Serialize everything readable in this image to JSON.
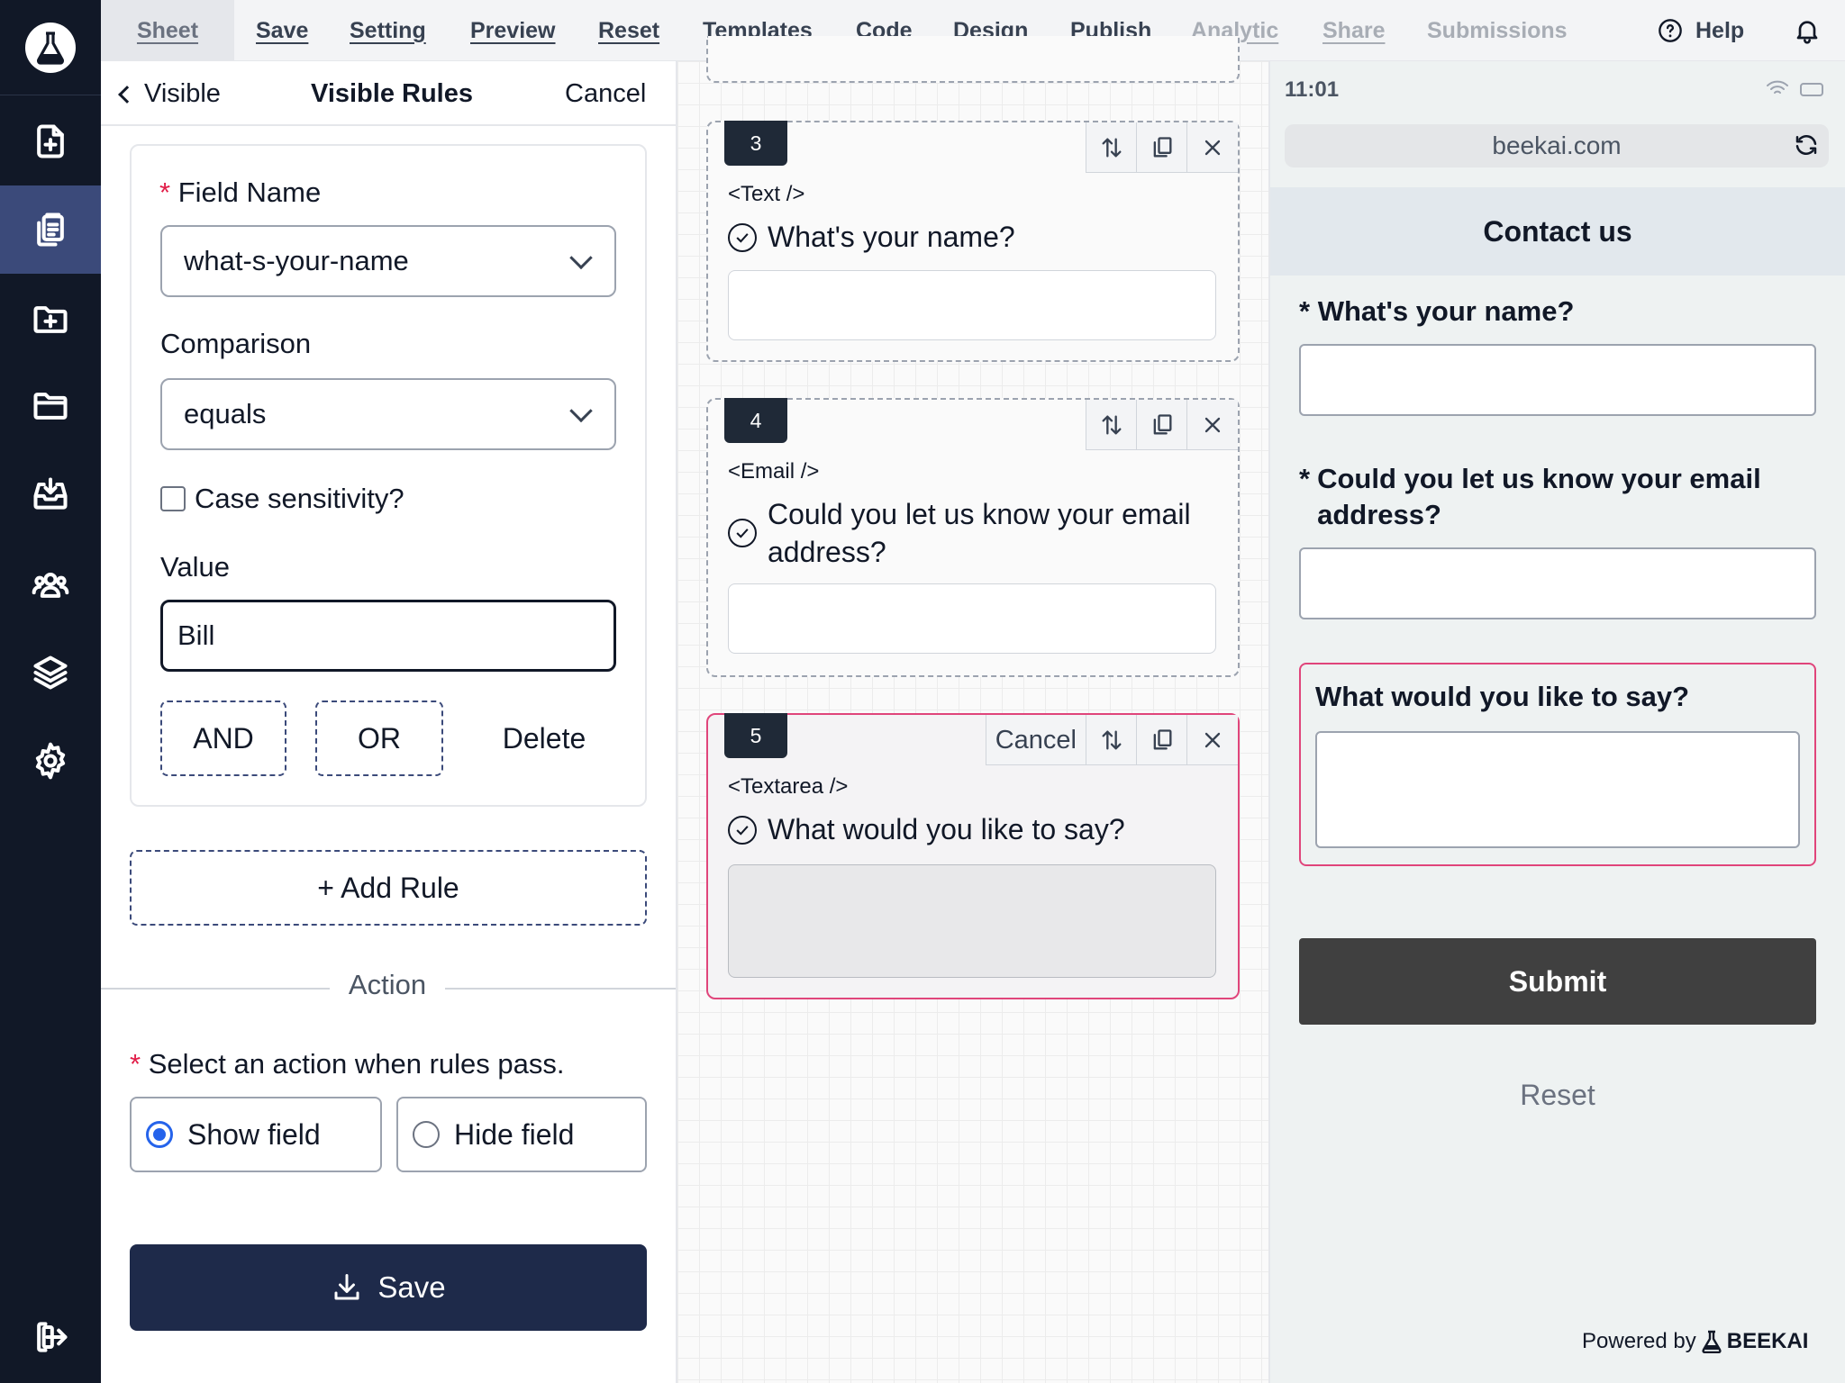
{
  "menu": {
    "items": [
      {
        "label": "Sheet",
        "state": "active"
      },
      {
        "label": "Save",
        "state": "normal"
      },
      {
        "label": "Setting",
        "state": "normal"
      },
      {
        "label": "Preview",
        "state": "normal"
      },
      {
        "label": "Reset",
        "state": "normal"
      },
      {
        "label": "Templates",
        "state": "normal"
      },
      {
        "label": "Code",
        "state": "normal"
      },
      {
        "label": "Design",
        "state": "normal"
      },
      {
        "label": "Publish",
        "state": "normal"
      },
      {
        "label": "Analytic",
        "state": "disabled"
      },
      {
        "label": "Share",
        "state": "disabled"
      },
      {
        "label": "Submissions",
        "state": "disabled"
      }
    ],
    "help": "Help"
  },
  "sidebar": {
    "icons": [
      "logo-flask-icon",
      "file-add-icon",
      "clipboard-copy-icon",
      "folder-add-icon",
      "folder-icon",
      "inbox-download-icon",
      "users-icon",
      "layers-icon",
      "gear-icon",
      "logout-icon"
    ],
    "active_index": 1
  },
  "rules_panel": {
    "back_label": "Visible",
    "title": "Visible Rules",
    "cancel_label": "Cancel",
    "field_name_label": "Field Name",
    "field_name_value": "what-s-your-name",
    "comparison_label": "Comparison",
    "comparison_value": "equals",
    "case_sensitivity_label": "Case sensitivity?",
    "case_sensitivity_checked": false,
    "value_label": "Value",
    "value": "Bill",
    "and_label": "AND",
    "or_label": "OR",
    "delete_label": "Delete",
    "add_rule_label": "+ Add Rule",
    "action_divider": "Action",
    "action_prompt": "Select an action when rules pass.",
    "show_field_label": "Show field",
    "hide_field_label": "Hide field",
    "selected_action": "show",
    "save_label": "Save"
  },
  "canvas": {
    "fields": [
      {
        "number": "3",
        "tag": "<Text />",
        "question": "What's your name?"
      },
      {
        "number": "4",
        "tag": "<Email />",
        "question": "Could you let us know your email address?"
      },
      {
        "number": "5",
        "tag": "<Textarea />",
        "question": "What would you like to say?",
        "cancel_label": "Cancel",
        "selected": true
      }
    ]
  },
  "preview": {
    "time": "11:01",
    "url": "beekai.com",
    "form_title": "Contact us",
    "q1": "What's your name?",
    "q2": "Could you let us know your email address?",
    "q3": "What would you like to say?",
    "required_mark": "*",
    "submit_label": "Submit",
    "reset_label": "Reset",
    "powered_by": "Powered by",
    "brand": "BEEKAI"
  },
  "colors": {
    "sidebar": "#111827",
    "accent": "#1e2a4a",
    "selected_border": "#e0457b",
    "radio": "#2563eb"
  }
}
